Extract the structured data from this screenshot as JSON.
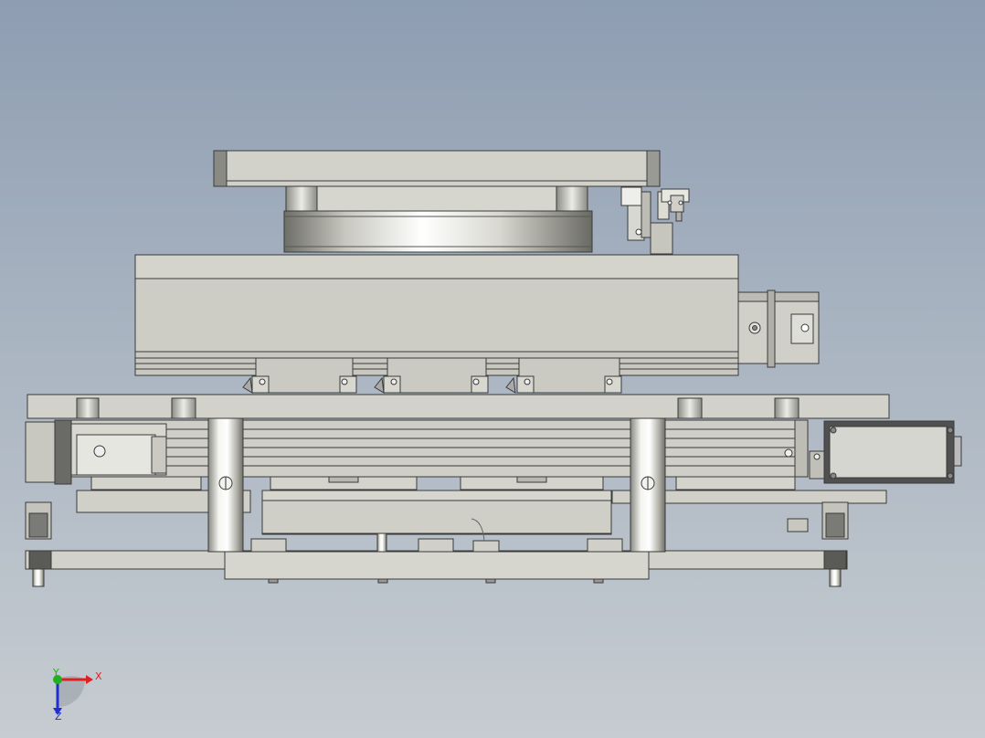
{
  "viewport": {
    "background_top": "#8e9db2",
    "background_bottom": "#c6ccd1"
  },
  "model": {
    "part_fill": "#cfcfc6",
    "part_edge": "#3a3a3a",
    "dark_part_fill": "#5a5a5a",
    "steel_fill": "#e6e6e2"
  },
  "triad": {
    "x_label": "X",
    "y_label": "Y",
    "z_label": "Z",
    "x_color": "#e02020",
    "y_color": "#20b020",
    "z_color": "#2030d0"
  }
}
